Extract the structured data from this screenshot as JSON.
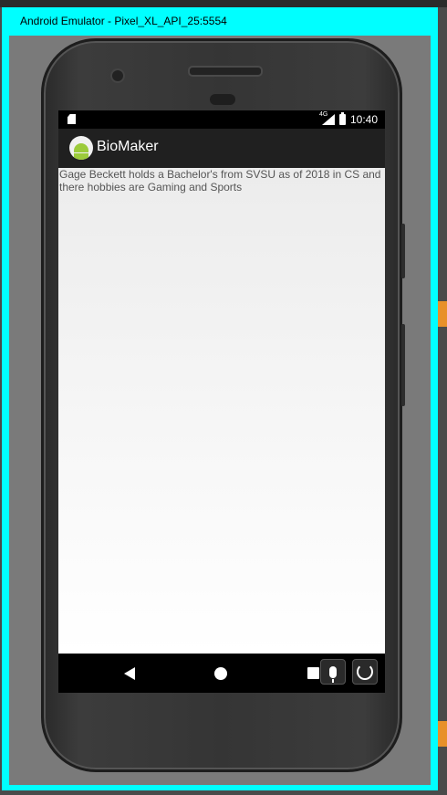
{
  "window": {
    "title": "Android Emulator - Pixel_XL_API_25:5554"
  },
  "status_bar": {
    "time": "10:40",
    "network": "4G"
  },
  "app": {
    "title": "BioMaker",
    "bio_text": "Gage Beckett holds a Bachelor's from SVSU as of 2018 in CS and there hobbies are Gaming and Sports"
  },
  "colors": {
    "window_frame": "#00ffff",
    "app_bar": "#202020",
    "android_green": "#9ccb3b"
  },
  "icons": [
    "sd-card-icon",
    "signal-icon",
    "battery-icon",
    "android-logo-icon",
    "back-icon",
    "home-icon",
    "recents-icon",
    "microphone-icon",
    "rotate-icon"
  ]
}
